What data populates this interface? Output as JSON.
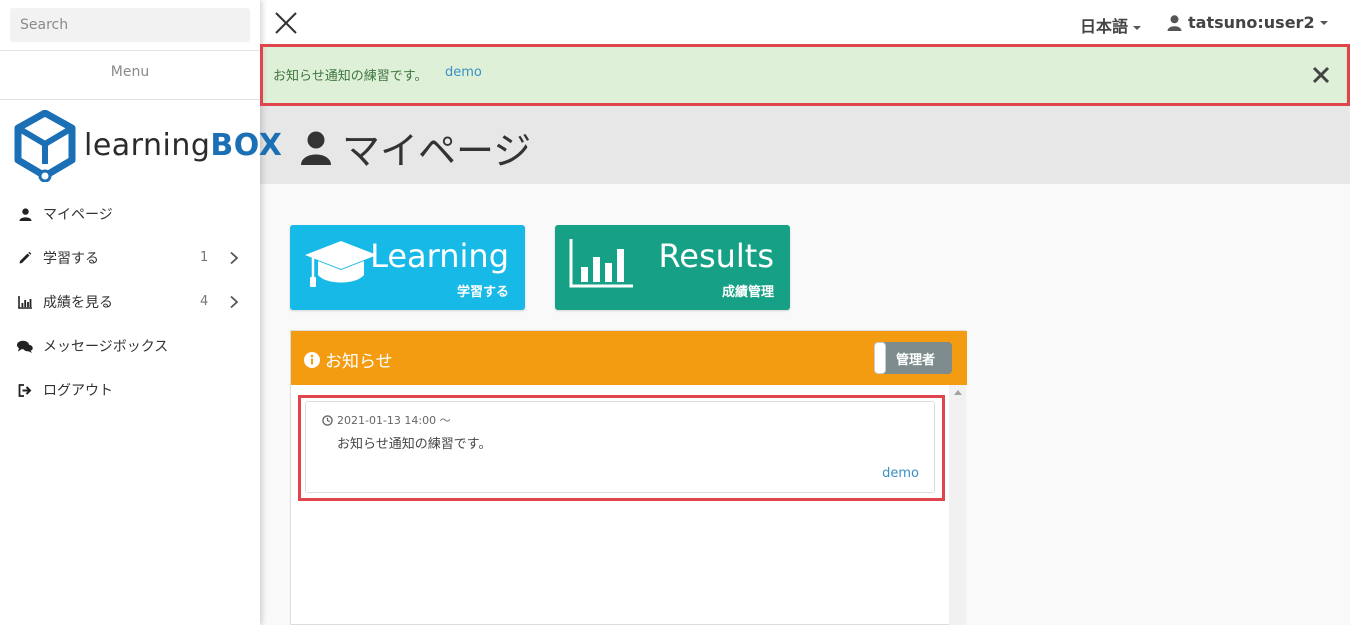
{
  "sidebar": {
    "search_placeholder": "Search",
    "menu_label": "Menu",
    "logo": {
      "part1": "learning",
      "part2": "BOX"
    },
    "items": [
      {
        "label": "マイページ",
        "icon": "user-icon"
      },
      {
        "label": "学習する",
        "icon": "pencil-icon",
        "count": "1"
      },
      {
        "label": "成績を見る",
        "icon": "bar-chart-icon",
        "count": "4"
      },
      {
        "label": "メッセージボックス",
        "icon": "comments-icon"
      },
      {
        "label": "ログアウト",
        "icon": "sign-out-icon"
      }
    ]
  },
  "topbar": {
    "language": "日本語",
    "user": "tatsuno:user2"
  },
  "alert": {
    "text": "お知らせ通知の練習です。",
    "link": "demo"
  },
  "page": {
    "title": "マイページ"
  },
  "tiles": [
    {
      "title": "Learning",
      "subtitle": "学習する",
      "color": "#17b9e6"
    },
    {
      "title": "Results",
      "subtitle": "成績管理",
      "color": "#16a085"
    }
  ],
  "notice": {
    "title": "お知らせ",
    "admin_label": "管理者",
    "items": [
      {
        "date": "2021-01-13 14:00 ～",
        "text": "お知らせ通知の練習です。",
        "author": "demo"
      }
    ]
  },
  "colors": {
    "panel_header": "#f39c12",
    "alert_bg": "#dff0d8",
    "highlight_border": "#e0454b",
    "link": "#3a8fc4"
  }
}
